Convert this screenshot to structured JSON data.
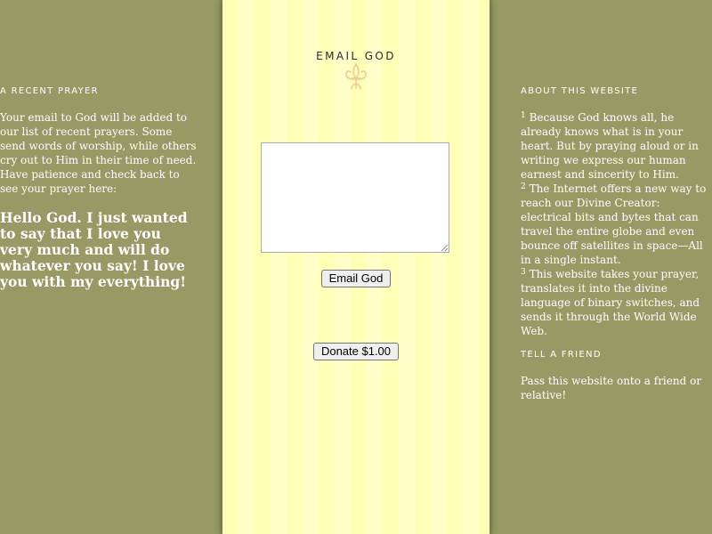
{
  "colors": {
    "background": "#999966",
    "center_stripe_light": "#ffffc8",
    "center_stripe_dark": "#ffffb8",
    "logo_text": "#2a2a3a",
    "fleur_de_lis": "#f5c89a"
  },
  "logo": {
    "title": "EMAIL GOD",
    "icon": "fleur-de-lis-icon"
  },
  "form": {
    "prayer_value": "",
    "email_button": "Email God",
    "donate_button": "Donate $1.00"
  },
  "left": {
    "heading": "A RECENT PRAYER",
    "intro": "Your email to God will be added to our list of recent prayers. Some send words of worship, while others cry out to Him in their time of need. Have patience and check back to see your prayer here:",
    "recent_prayer": "Hello God. I just wanted to say that I love you very much and will do whatever you say! I love you with my everything!"
  },
  "right": {
    "heading": "ABOUT THIS WEBSITE",
    "notes": [
      {
        "num": "1",
        "text": "Because God knows all, he already knows what is in your heart. But by praying aloud or in writing we express our human earnest and sincerity to Him."
      },
      {
        "num": "2",
        "text": "The Internet offers a new way to reach our Divine Creator: electrical bits and bytes that can travel the entire globe and even bounce off satellites in space—All in a single instant."
      },
      {
        "num": "3",
        "text": "This website takes your prayer, translates it into the divine language of binary switches, and sends it through the World Wide Web."
      }
    ],
    "tell_heading": "TELL A FRIEND",
    "tell_text": "Pass this website onto a friend or relative!"
  }
}
